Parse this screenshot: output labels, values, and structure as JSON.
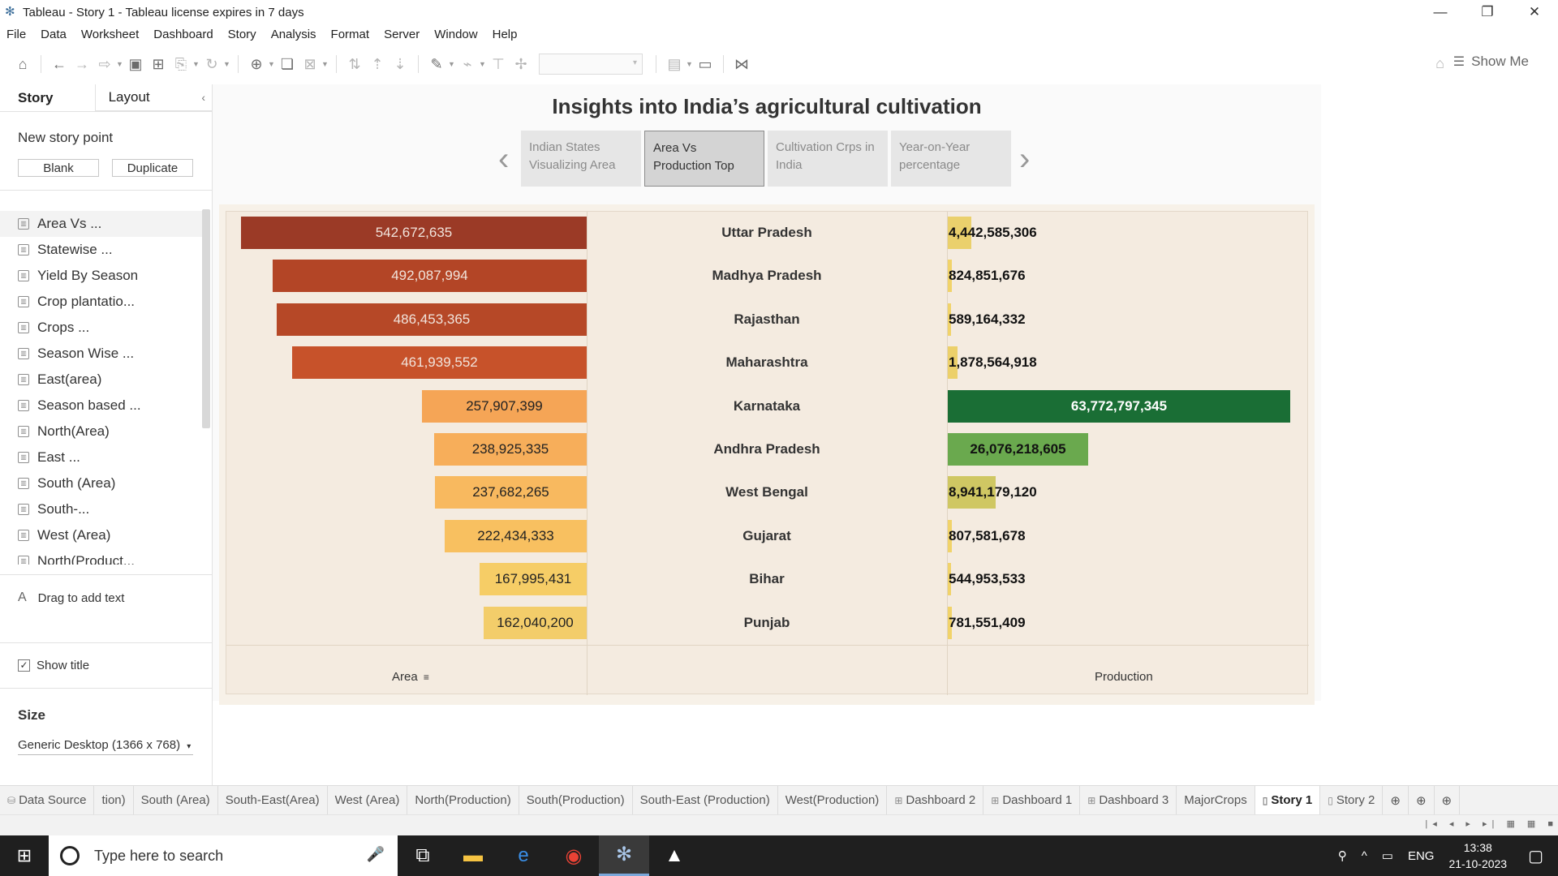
{
  "window": {
    "title": "Tableau - Story 1 - Tableau license expires in 7 days",
    "controls": [
      "—",
      "❐",
      "✕"
    ]
  },
  "menu": [
    "File",
    "Data",
    "Worksheet",
    "Dashboard",
    "Story",
    "Analysis",
    "Format",
    "Server",
    "Window",
    "Help"
  ],
  "toolbar": {
    "show_me": "Show Me"
  },
  "left_panel": {
    "tab_story": "Story",
    "tab_layout": "Layout",
    "new_story_point": "New story point",
    "blank_button": "Blank",
    "duplicate_button": "Duplicate",
    "sheets": [
      "Area Vs ...",
      "Statewise ...",
      "Yield By Season",
      "Crop plantatio...",
      "Crops ...",
      "Season Wise ...",
      "East(area)",
      "Season based ...",
      "North(Area)",
      "East ...",
      "South (Area)",
      "South-...",
      "West (Area)",
      "North(Product..."
    ],
    "drag_text": "Drag to add text",
    "show_title": "Show title",
    "size_heading": "Size",
    "size_value": "Generic Desktop (1366 x 768)"
  },
  "story": {
    "title": "Insights into India’s agricultural cultivation",
    "points": [
      {
        "line1": "Indian States",
        "line2": "Visualizing Area"
      },
      {
        "line1": "Area Vs",
        "line2": "Production Top"
      },
      {
        "line1": "Cultivation Crps in",
        "line2": "India"
      },
      {
        "line1": "Year-on-Year",
        "line2": "percentage"
      }
    ],
    "active_point": 1
  },
  "chart_data": {
    "type": "bar",
    "categories": [
      "Uttar Pradesh",
      "Madhya Pradesh",
      "Rajasthan",
      "Maharashtra",
      "Karnataka",
      "Andhra Pradesh",
      "West Bengal",
      "Gujarat",
      "Bihar",
      "Punjab"
    ],
    "series": [
      {
        "name": "Area",
        "values": [
          542672635,
          492087994,
          486453365,
          461939552,
          257907399,
          238925335,
          237682265,
          222434333,
          167995431,
          162040200
        ],
        "labels": [
          "542,672,635",
          "492,087,994",
          "486,453,365",
          "461,939,552",
          "257,907,399",
          "238,925,335",
          "237,682,265",
          "222,434,333",
          "167,995,431",
          "162,040,200"
        ],
        "colors": [
          "#9b3a26",
          "#b34526",
          "#b64827",
          "#c7522a",
          "#f5a556",
          "#f7ae5a",
          "#f8b95f",
          "#f8c060",
          "#f6cd66",
          "#f3cd6a"
        ],
        "label_colors": [
          "#f1e4dc",
          "#f1e4dc",
          "#f1e4dc",
          "#f1e4dc",
          "#222",
          "#222",
          "#222",
          "#222",
          "#222",
          "#222"
        ]
      },
      {
        "name": "Production",
        "values": [
          4442585306,
          824851676,
          589164332,
          1878564918,
          63772797345,
          26076218605,
          8941179120,
          807581678,
          544953533,
          781551409
        ],
        "labels": [
          "4,442,585,306",
          "824,851,676",
          "589,164,332",
          "1,878,564,918",
          "63,772,797,345",
          "26,076,218,605",
          "8,941,179,120",
          "807,581,678",
          "544,953,533",
          "781,551,409"
        ],
        "colors": [
          "#ead06c",
          "#f1d36a",
          "#f1d36a",
          "#ecd06a",
          "#1a6e35",
          "#6aa94e",
          "#cfc763",
          "#f1d36a",
          "#f1d36a",
          "#f1d36a"
        ],
        "label_colors": [
          "#111",
          "#111",
          "#111",
          "#111",
          "#ffffff",
          "#111",
          "#111",
          "#111",
          "#111",
          "#111"
        ]
      }
    ],
    "xlabel_area": "Area",
    "xlabel_production": "Production",
    "sort": "descending by Area"
  },
  "sheet_tabs": [
    {
      "label": "Data Source",
      "icon": "database-icon"
    },
    {
      "label": "tion)",
      "icon": ""
    },
    {
      "label": "South (Area)",
      "icon": ""
    },
    {
      "label": "South-East(Area)",
      "icon": ""
    },
    {
      "label": "West (Area)",
      "icon": ""
    },
    {
      "label": "North(Production)",
      "icon": ""
    },
    {
      "label": "South(Production)",
      "icon": ""
    },
    {
      "label": "South-East (Production)",
      "icon": ""
    },
    {
      "label": "West(Production)",
      "icon": ""
    },
    {
      "label": "Dashboard 2",
      "icon": "dashboard-icon"
    },
    {
      "label": "Dashboard 1",
      "icon": "dashboard-icon"
    },
    {
      "label": "Dashboard 3",
      "icon": "dashboard-icon"
    },
    {
      "label": "MajorCrops",
      "icon": ""
    },
    {
      "label": "Story 1",
      "icon": "story-icon",
      "active": true
    },
    {
      "label": "Story 2",
      "icon": "story-icon"
    }
  ],
  "taskbar": {
    "search_placeholder": "Type here to search",
    "language": "ENG",
    "time": "13:38",
    "date": "21-10-2023"
  }
}
